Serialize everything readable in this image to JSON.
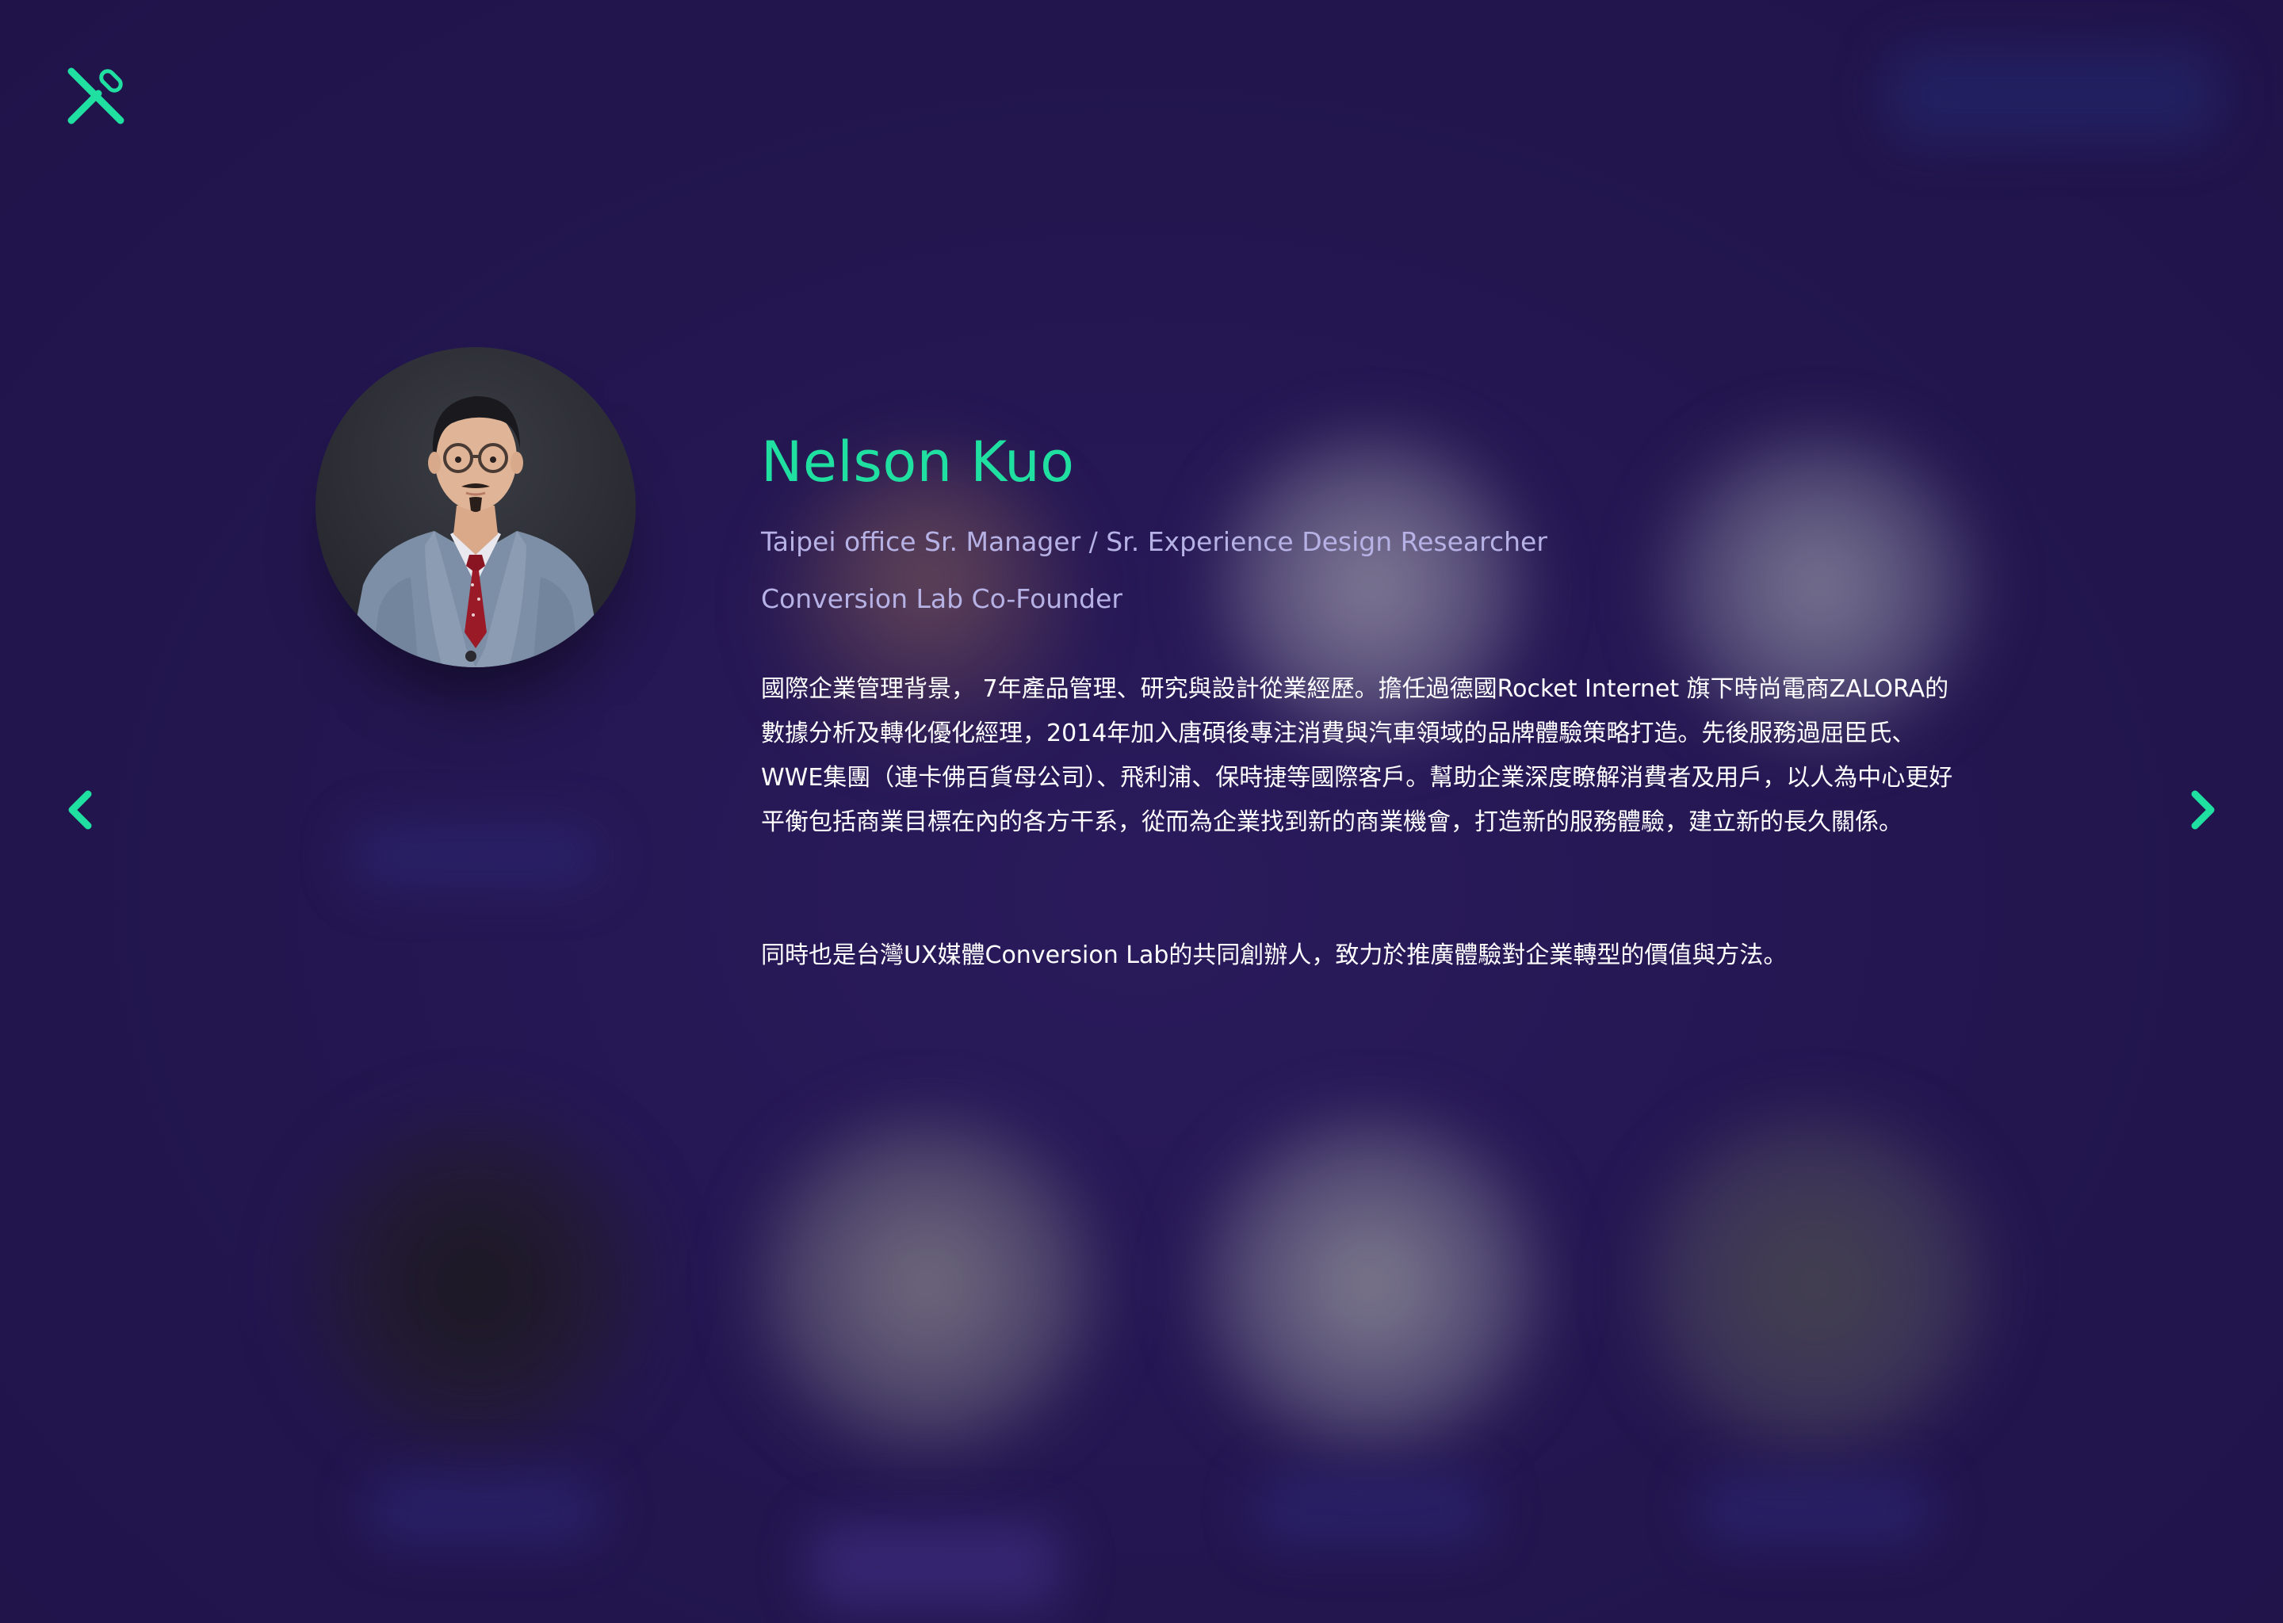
{
  "brand": {
    "logo_icon": "crossed-pencil-ruler-icon",
    "accent_color": "#1fe0a0",
    "background_color": "#23164f"
  },
  "profile": {
    "name": "Nelson Kuo",
    "title_line_1": "Taipei office Sr. Manager / Sr. Experience Design Researcher",
    "title_line_2": "Conversion Lab Co-Founder",
    "bio_paragraph_1": "國際企業管理背景， 7年產品管理、研究與設計從業經歷。擔任過德國Rocket Internet 旗下時尚電商ZALORA的數據分析及轉化優化經理，2014年加入唐碩後專注消費與汽車領域的品牌體驗策略打造。先後服務過屈臣氏、WWE集團（連卡佛百貨母公司）、飛利浦、保時捷等國際客戶。幫助企業深度瞭解消費者及用戶，以人為中心更好平衡包括商業目標在內的各方干系，從而為企業找到新的商業機會，打造新的服務體驗，建立新的長久關係。",
    "bio_paragraph_2": "同時也是台灣UX媒體Conversion Lab的共同創辦人，致力於推廣體驗對企業轉型的價值與方法。",
    "photo_icon": "portrait-photo"
  },
  "navigation": {
    "prev_icon": "chevron-left-icon",
    "next_icon": "chevron-right-icon"
  }
}
